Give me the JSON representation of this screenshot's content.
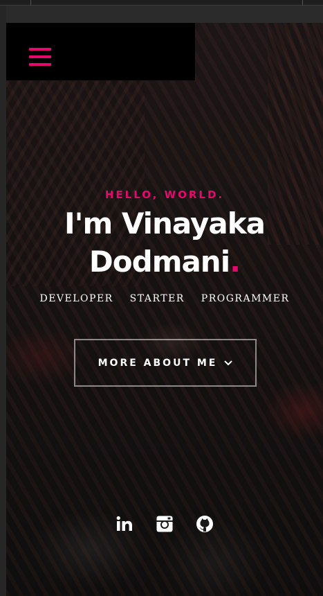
{
  "menu": {
    "icon": "hamburger-menu-icon",
    "accent_color": "#e5096e"
  },
  "hero": {
    "kicker": "HELLO, WORLD.",
    "headline_line1": "I'm Vinayaka",
    "headline_line2": "Dodmani",
    "headline_dot": ".",
    "roles": [
      "DEVELOPER",
      "STARTER",
      "PROGRAMMER"
    ],
    "cta": {
      "label": "MORE ABOUT ME",
      "icon": "chevron-down-icon"
    }
  },
  "social": [
    {
      "name": "linkedin",
      "icon": "linkedin-icon"
    },
    {
      "name": "instagram",
      "icon": "instagram-icon"
    },
    {
      "name": "github",
      "icon": "github-icon"
    }
  ],
  "colors": {
    "accent": "#e5096e",
    "text": "#ffffff",
    "menu_bg": "#000000"
  }
}
